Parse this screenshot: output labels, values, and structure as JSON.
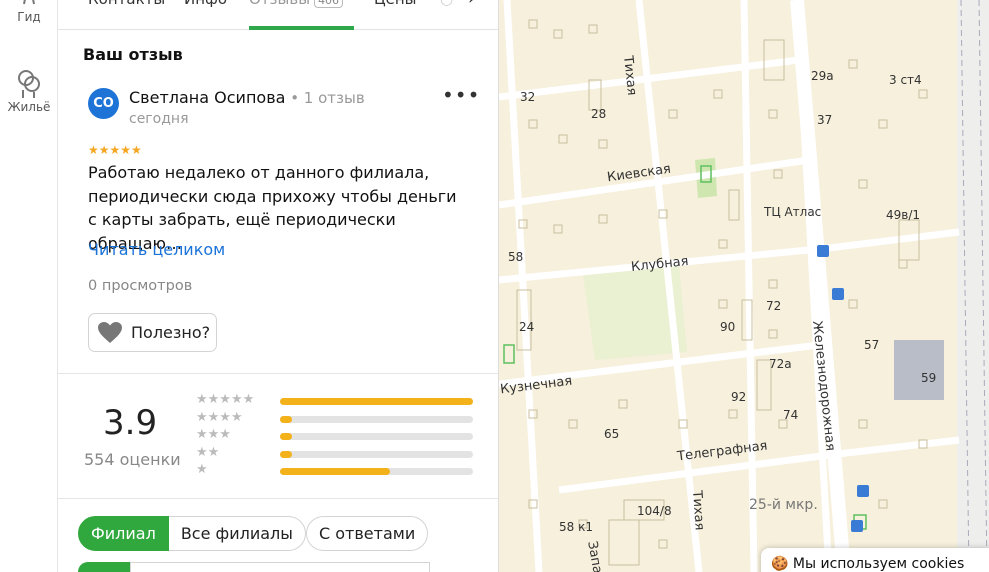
{
  "rail": {
    "items": [
      {
        "label": "Гид",
        "icon": "guide-icon"
      },
      {
        "label": "Жильё",
        "icon": "housing-icon"
      }
    ]
  },
  "tabs": [
    {
      "label": "Контакты"
    },
    {
      "label": "Инфо"
    },
    {
      "label": "Отзывы",
      "count": "406",
      "active": true
    },
    {
      "label": "Цены"
    }
  ],
  "review": {
    "section_title": "Ваш отзыв",
    "avatar_initials": "СО",
    "author": "Светлана Осипова",
    "author_meta": " • 1 отзыв",
    "date": "сегодня",
    "rating": 5,
    "text": "Работаю недалеко от данного филиала, периодически сюда прихожу чтобы деньги с карты забрать, ещё периодически обращаю…",
    "read_more": "Читать целиком",
    "views": "0 просмотров",
    "useful_label": "Полезно?"
  },
  "summary": {
    "rating": "3.9",
    "count_label": "554 оценки",
    "distribution": [
      {
        "stars": 5,
        "fraction": 1.0
      },
      {
        "stars": 4,
        "fraction": 0.06
      },
      {
        "stars": 3,
        "fraction": 0.06
      },
      {
        "stars": 2,
        "fraction": 0.06
      },
      {
        "stars": 1,
        "fraction": 0.57
      }
    ]
  },
  "filters": {
    "branch": "Филиал",
    "all_branches": "Все филиалы",
    "with_answers": "С ответами"
  },
  "map": {
    "streets": [
      "Тихая",
      "Киевская",
      "Клубная",
      "Кузнечная",
      "Телеграфная",
      "Железнодорожная",
      "Тихая",
      "Западн"
    ],
    "labels": [
      "32",
      "28",
      "29а",
      "3 ст4",
      "37",
      "49в/1",
      "ТЦ Атлас",
      "58",
      "24",
      "90",
      "72",
      "57",
      "72а",
      "59",
      "92",
      "74",
      "65",
      "104/8",
      "25-й мкр.",
      "58 к1"
    ]
  },
  "cookie_text": "Мы используем cookies",
  "colors": {
    "accent_green": "#31a83d",
    "link_blue": "#1a73d9",
    "star_gold": "#f3b21a"
  }
}
